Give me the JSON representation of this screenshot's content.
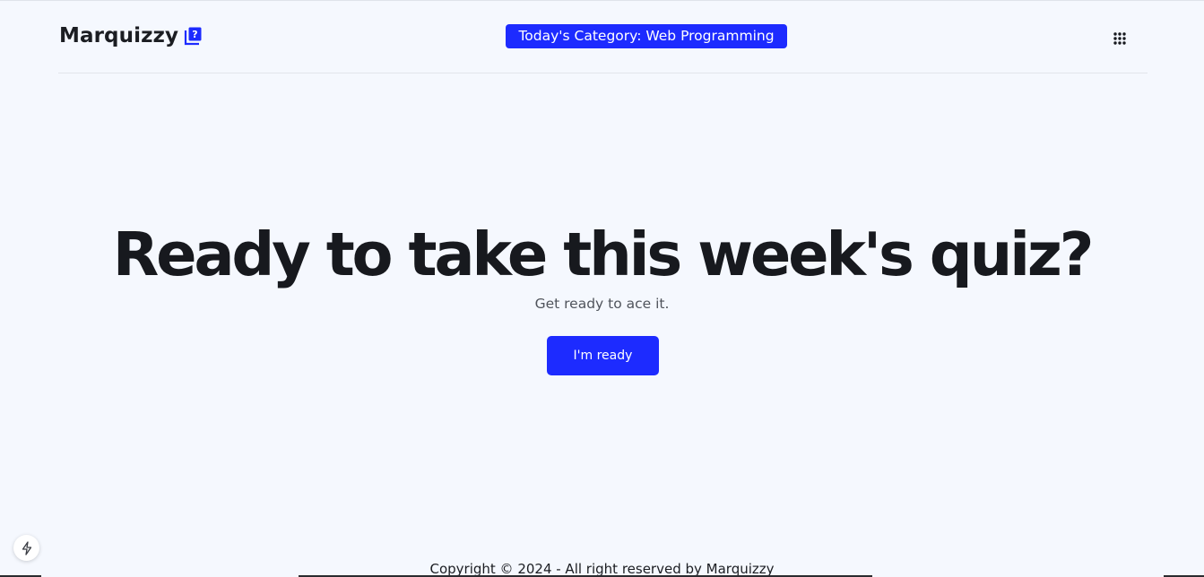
{
  "header": {
    "brand_name": "Marquizzy",
    "brand_icon": "book-question-icon",
    "category_badge": "Today's Category: Web Programming",
    "menu_icon": "grid-menu-icon"
  },
  "hero": {
    "title": "Ready to take this week's quiz?",
    "subtitle": "Get ready to ace it.",
    "cta_label": "I'm ready"
  },
  "footer": {
    "copyright": "Copyright © 2024 - All right reserved by Marquizzy"
  },
  "floating": {
    "icon": "lightning-bolt-icon"
  },
  "colors": {
    "accent": "#1d2bff",
    "background": "#f5f8fe",
    "text": "#1b1d22"
  }
}
